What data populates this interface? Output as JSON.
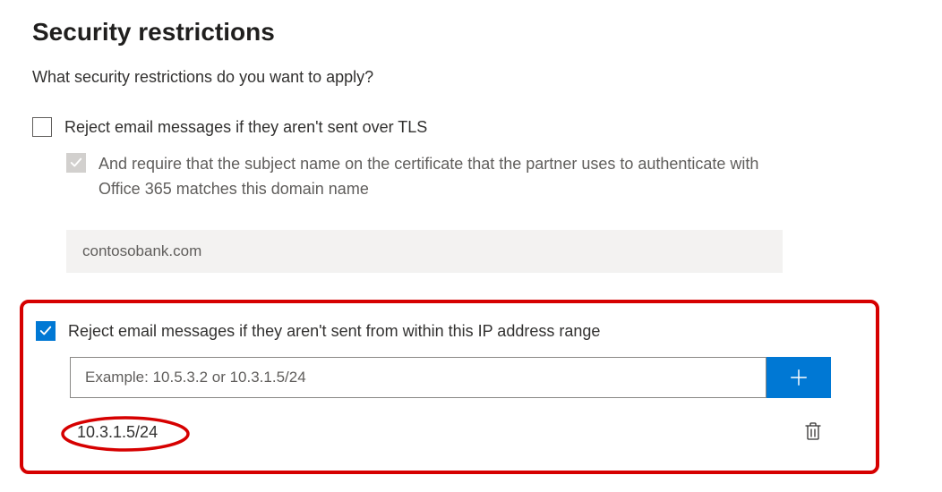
{
  "title": "Security restrictions",
  "intro": "What security restrictions do you want to apply?",
  "tls": {
    "label": "Reject email messages if they aren't sent over TLS",
    "checked": false,
    "sub": {
      "label": "And require that the subject name on the certificate that the partner uses to authenticate with Office 365 matches this domain name",
      "checked": false,
      "domain_value": "contosobank.com"
    }
  },
  "ip": {
    "label": "Reject email messages if they aren't sent from within this IP address range",
    "checked": true,
    "placeholder": "Example: 10.5.3.2 or 10.3.1.5/24",
    "value": "",
    "entries": [
      "10.3.1.5/24"
    ]
  }
}
